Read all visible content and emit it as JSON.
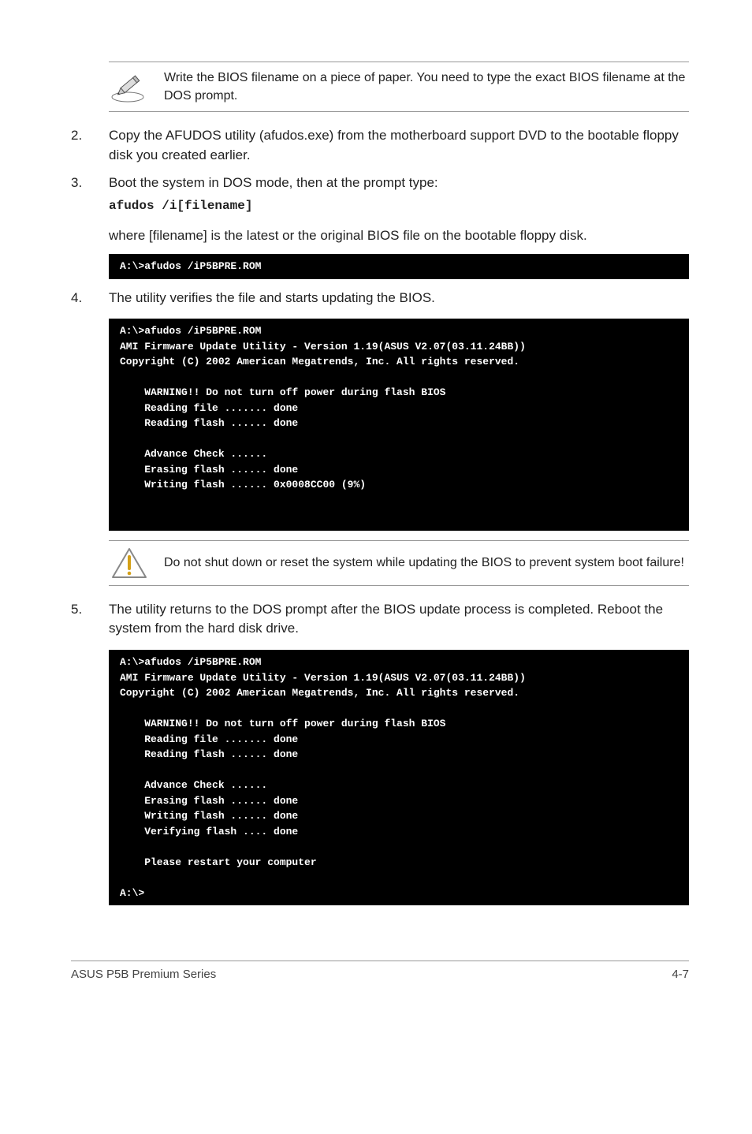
{
  "note1": {
    "text": "Write the BIOS filename on a piece of paper. You need to type the exact BIOS filename at the DOS prompt."
  },
  "steps_a": [
    {
      "num": "2.",
      "text": "Copy the AFUDOS utility (afudos.exe) from the motherboard support DVD to the bootable floppy disk you created earlier."
    },
    {
      "num": "3.",
      "text": "Boot the system in DOS mode, then at the prompt type:",
      "cmd": "afudos /i[filename]"
    }
  ],
  "sub_para": "where [filename] is the latest or the original BIOS file on the bootable floppy disk.",
  "terminal1": "A:\\>afudos /iP5BPRE.ROM",
  "step4": {
    "num": "4.",
    "text": "The utility verifies the file and starts updating the BIOS."
  },
  "terminal2": "A:\\>afudos /iP5BPRE.ROM\nAMI Firmware Update Utility - Version 1.19(ASUS V2.07(03.11.24BB))\nCopyright (C) 2002 American Megatrends, Inc. All rights reserved.\n\n    WARNING!! Do not turn off power during flash BIOS\n    Reading file ....... done\n    Reading flash ...... done\n\n    Advance Check ......\n    Erasing flash ...... done\n    Writing flash ...... 0x0008CC00 (9%)",
  "note2": {
    "text": "Do not shut down or reset the system while updating the BIOS to prevent system boot failure!"
  },
  "step5": {
    "num": "5.",
    "text": "The utility returns to the DOS prompt after the BIOS update process is completed. Reboot the system from the hard disk drive."
  },
  "terminal3": "A:\\>afudos /iP5BPRE.ROM\nAMI Firmware Update Utility - Version 1.19(ASUS V2.07(03.11.24BB))\nCopyright (C) 2002 American Megatrends, Inc. All rights reserved.\n\n    WARNING!! Do not turn off power during flash BIOS\n    Reading file ....... done\n    Reading flash ...... done\n\n    Advance Check ......\n    Erasing flash ...... done\n    Writing flash ...... done\n    Verifying flash .... done\n\n    Please restart your computer\n\nA:\\>",
  "footer": {
    "left": "ASUS P5B Premium Series",
    "right": "4-7"
  }
}
